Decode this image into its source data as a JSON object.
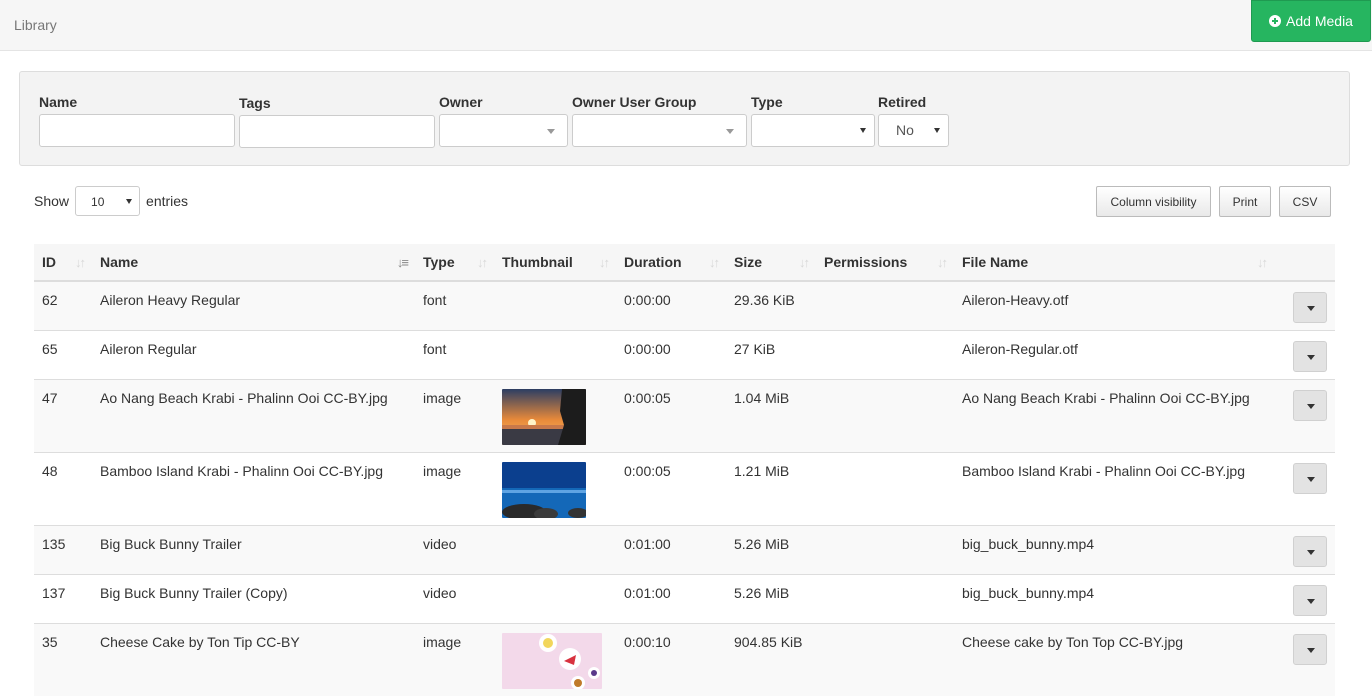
{
  "header": {
    "title": "Library",
    "add_media_label": "Add Media",
    "accent": "#26b560"
  },
  "filters": {
    "name_label": "Name",
    "tags_label": "Tags",
    "owner_label": "Owner",
    "owner_group_label": "Owner User Group",
    "type_label": "Type",
    "retired_label": "Retired",
    "retired_value": "No"
  },
  "table_controls": {
    "show_label": "Show",
    "entries_value": "10",
    "entries_label": "entries",
    "column_visibility_label": "Column visibility",
    "print_label": "Print",
    "csv_label": "CSV"
  },
  "columns": [
    "ID",
    "Name",
    "Type",
    "Thumbnail",
    "Duration",
    "Size",
    "Permissions",
    "File Name"
  ],
  "rows": [
    {
      "id": "62",
      "name": "Aileron Heavy Regular",
      "type": "font",
      "thumbnail": "",
      "duration": "0:00:00",
      "size": "29.36 KiB",
      "permissions": "",
      "file_name": "Aileron-Heavy.otf"
    },
    {
      "id": "65",
      "name": "Aileron Regular",
      "type": "font",
      "thumbnail": "",
      "duration": "0:00:00",
      "size": "27 KiB",
      "permissions": "",
      "file_name": "Aileron-Regular.otf"
    },
    {
      "id": "47",
      "name": "Ao Nang Beach Krabi - Phalinn Ooi CC-BY.jpg",
      "type": "image",
      "thumbnail": "sunset-beach",
      "duration": "0:00:05",
      "size": "1.04 MiB",
      "permissions": "",
      "file_name": "Ao Nang Beach Krabi - Phalinn Ooi CC-BY.jpg"
    },
    {
      "id": "48",
      "name": "Bamboo Island Krabi - Phalinn Ooi CC-BY.jpg",
      "type": "image",
      "thumbnail": "blue-sea-rocks",
      "duration": "0:00:05",
      "size": "1.21 MiB",
      "permissions": "",
      "file_name": "Bamboo Island Krabi - Phalinn Ooi CC-BY.jpg"
    },
    {
      "id": "135",
      "name": "Big Buck Bunny Trailer",
      "type": "video",
      "thumbnail": "",
      "duration": "0:01:00",
      "size": "5.26 MiB",
      "permissions": "",
      "file_name": "big_buck_bunny.mp4"
    },
    {
      "id": "137",
      "name": "Big Buck Bunny Trailer (Copy)",
      "type": "video",
      "thumbnail": "",
      "duration": "0:01:00",
      "size": "5.26 MiB",
      "permissions": "",
      "file_name": "big_buck_bunny.mp4"
    },
    {
      "id": "35",
      "name": "Cheese Cake by Ton Tip CC-BY",
      "type": "image",
      "thumbnail": "cheesecake-plates",
      "duration": "0:00:10",
      "size": "904.85 KiB",
      "permissions": "",
      "file_name": "Cheese cake by Ton Top CC-BY.jpg"
    }
  ]
}
